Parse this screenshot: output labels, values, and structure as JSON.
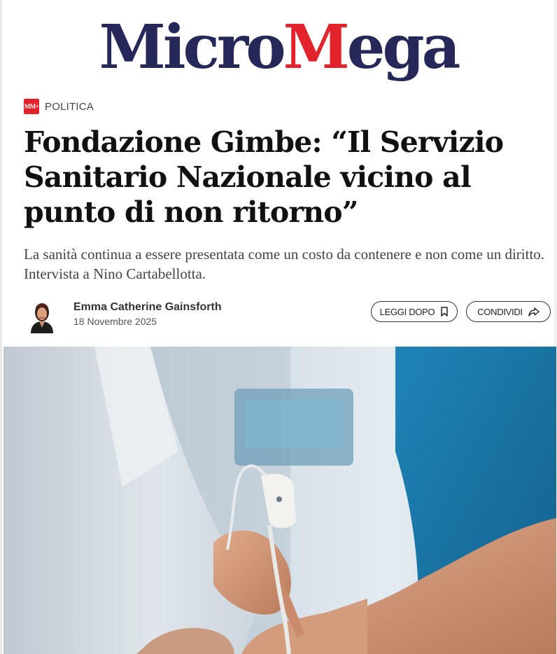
{
  "site": {
    "logo_part1": "Micro",
    "logo_part2": "M",
    "logo_part3": "ega"
  },
  "category": {
    "badge": "MM+",
    "label": "POLITICA"
  },
  "article": {
    "title": "Fondazione Gimbe: “Il Servizio Sanitario Nazionale vicino al punto di non ritorno”",
    "subtitle": "La sanità continua a essere presentata come un costo da contenere e non come un diritto. Intervista a Nino Cartabellotta.",
    "author": "Emma Catherine Gainsforth",
    "date": "18 Novembre 2025"
  },
  "actions": {
    "save_label": "LEGGI DOPO",
    "share_label": "CONDIVIDI"
  },
  "icons": {
    "save": "bookmark-icon",
    "share": "share-icon"
  },
  "colors": {
    "brand_navy": "#26285a",
    "brand_red": "#e3232b"
  }
}
